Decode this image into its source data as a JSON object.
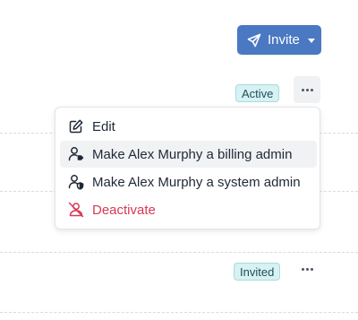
{
  "header": {
    "invite_label": "Invite"
  },
  "rows": [
    {
      "status": "Active"
    },
    {
      "status": "Invited"
    }
  ],
  "menu": {
    "items": [
      {
        "label": "Edit",
        "icon": "edit-icon"
      },
      {
        "label": "Make Alex Murphy a billing admin",
        "icon": "user-billing-icon"
      },
      {
        "label": "Make Alex Murphy a system admin",
        "icon": "user-shield-icon"
      },
      {
        "label": "Deactivate",
        "icon": "user-slash-icon"
      }
    ]
  },
  "colors": {
    "primary": "#4a78c2",
    "badge_bg": "#d8f1f2",
    "badge_border": "#a6dcdf",
    "danger": "#d63a55"
  }
}
